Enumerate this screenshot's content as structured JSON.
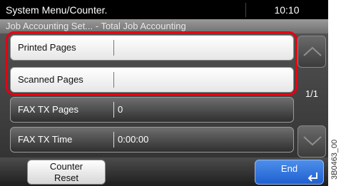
{
  "title_bar": {
    "title": "System Menu/Counter.",
    "time": "10:10"
  },
  "breadcrumb": "Job Accounting Set... - Total Job Accounting",
  "rows": [
    {
      "label": "Printed Pages",
      "value": "",
      "highlighted": true
    },
    {
      "label": "Scanned Pages",
      "value": "",
      "highlighted": true
    },
    {
      "label": "FAX TX Pages",
      "value": "0",
      "highlighted": false
    },
    {
      "label": "FAX TX Time",
      "value": "0:00:00",
      "highlighted": false
    }
  ],
  "page_indicator": "1/1",
  "buttons": {
    "counter_reset_line1": "Counter",
    "counter_reset_line2": "Reset",
    "end": "End"
  },
  "side_code": "3B0463_00",
  "colors": {
    "highlight": "#e60012",
    "end_button": "#2f6fdc"
  }
}
